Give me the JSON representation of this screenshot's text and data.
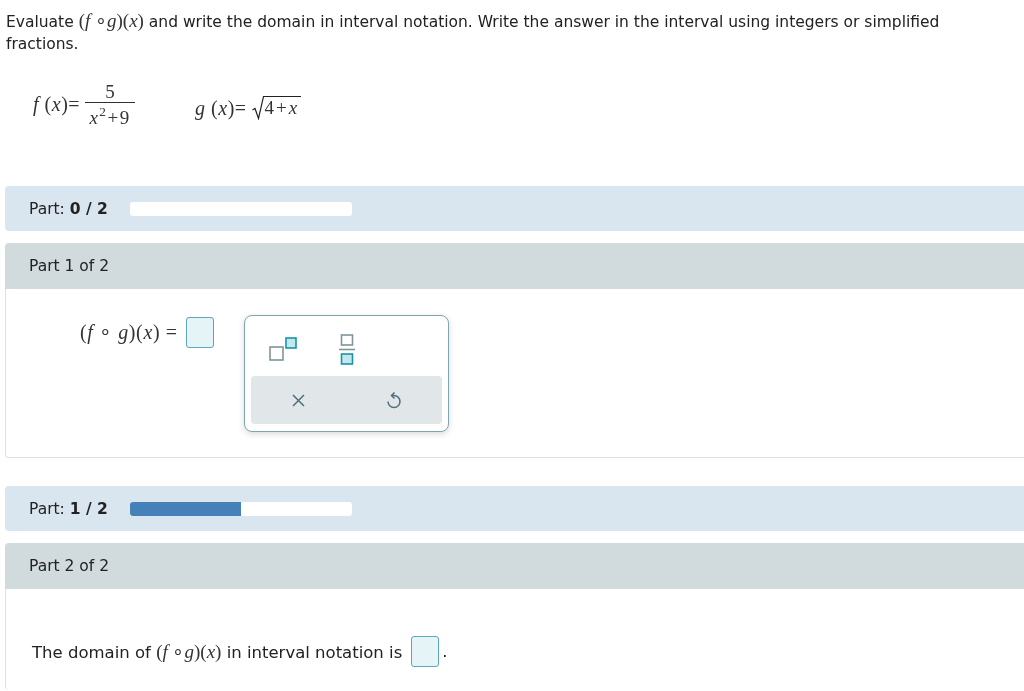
{
  "instructions": {
    "before": "Evaluate",
    "expression": "(*f* ∘*g*)(*x*)",
    "after": "and write the domain in interval notation. Write the answer in the interval using integers or simplified fractions."
  },
  "functions": [
    {
      "kind": "fraction",
      "lhs": "*f* (*x*)=",
      "numerator": "5",
      "denominator": "*x*$^{2}$+9"
    },
    {
      "kind": "radical",
      "lhs": "*g* (*x*)=",
      "radicand": "4+*x*"
    }
  ],
  "parts": [
    {
      "progress": {
        "label": "Part: **0 / 2**",
        "level": 0
      },
      "header": "Part 1 of 2",
      "kind": "equation",
      "prompt": "(*f* ∘ *g*)(*x*) =",
      "palette": {
        "tools": [
          {
            "kind": "superscript"
          },
          {
            "kind": "fraction"
          }
        ],
        "actions": [
          {
            "kind": "clear"
          },
          {
            "kind": "undo"
          }
        ]
      }
    },
    {
      "progress": {
        "label": "Part: **1 / 2**",
        "level": 0.5
      },
      "header": "Part 2 of 2",
      "kind": "sentence",
      "prompt": {
        "before": "The domain of",
        "expression": "(*f* ∘*g*)(*x*)",
        "after": "in interval notation is"
      },
      "ending": "."
    }
  ]
}
